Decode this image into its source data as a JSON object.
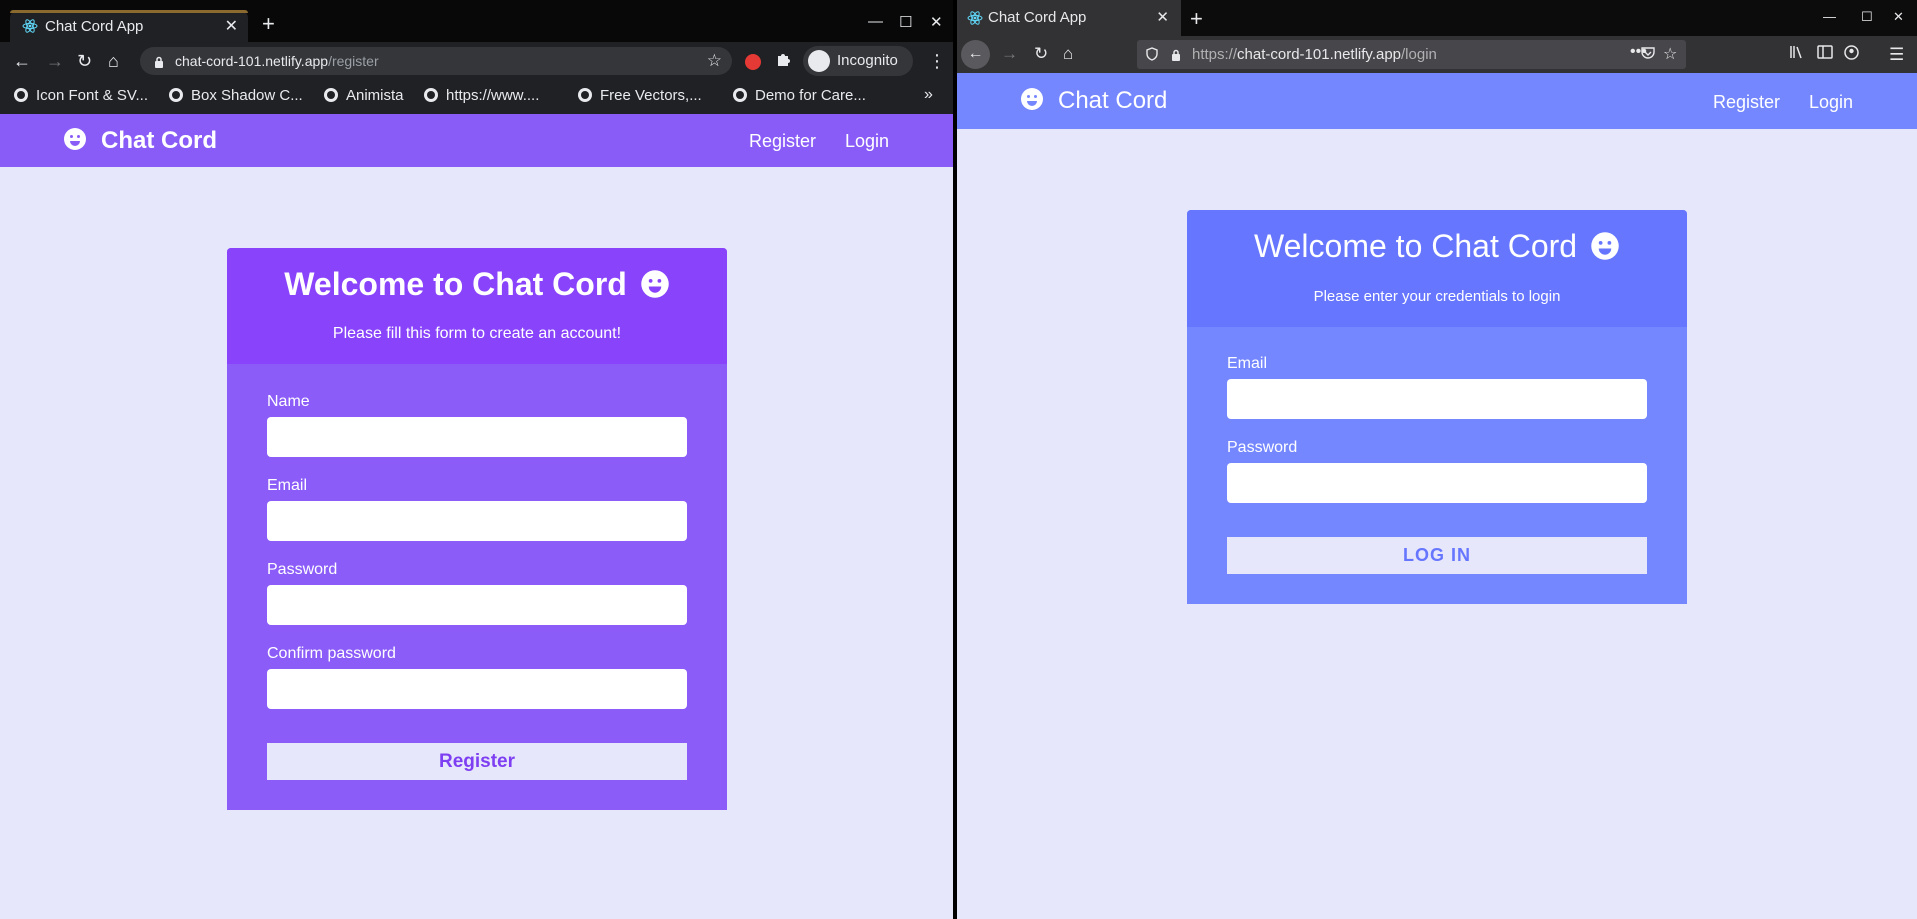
{
  "left_browser": {
    "tab_title": "Chat Cord App",
    "tab_close": "✕",
    "new_tab": "+",
    "window_controls": {
      "minimize": "—",
      "maximize": "☐",
      "close": "✕"
    },
    "nav": {
      "back": "←",
      "forward": "→",
      "reload": "↻",
      "home": "⌂"
    },
    "url_host": "chat-cord-101.netlify.app",
    "url_path": "/register",
    "star": "☆",
    "incognito_label": "Incognito",
    "menu": "⋮",
    "bookmarks": [
      "Icon Font & SV...",
      "Box Shadow C...",
      "Animista",
      "https://www....",
      "Free Vectors,...",
      "Demo for Care..."
    ],
    "bookmarks_more": "»"
  },
  "register_page": {
    "brand": "Chat Cord",
    "nav_links": {
      "register": "Register",
      "login": "Login"
    },
    "heading": "Welcome to Chat Cord",
    "subheading": "Please fill this form to create an account!",
    "fields": [
      {
        "label": "Name",
        "value": ""
      },
      {
        "label": "Email",
        "value": ""
      },
      {
        "label": "Password",
        "value": ""
      },
      {
        "label": "Confirm password",
        "value": ""
      }
    ],
    "submit_label": "Register",
    "colors": {
      "navbar": "#8a5cf7",
      "card_header": "#8843fb",
      "card_body": "#8b5cf8",
      "background": "#e7e7fb"
    }
  },
  "right_browser": {
    "tab_title": "Chat Cord App",
    "tab_close": "✕",
    "new_tab": "+",
    "window_controls": {
      "minimize": "—",
      "maximize": "☐",
      "close": "✕"
    },
    "nav": {
      "back": "←",
      "forward": "→",
      "reload": "↻",
      "home": "⌂"
    },
    "url_prefix": "https://",
    "url_host": "chat-cord-101.netlify.app",
    "url_path": "/login",
    "url_dots": "•••",
    "star": "☆",
    "menu": "☰"
  },
  "login_page": {
    "brand": "Chat Cord",
    "nav_links": {
      "register": "Register",
      "login": "Login"
    },
    "heading": "Welcome to Chat Cord",
    "subheading": "Please enter your credentials to login",
    "fields": [
      {
        "label": "Email",
        "value": ""
      },
      {
        "label": "Password",
        "value": ""
      }
    ],
    "submit_label": "LOG IN",
    "colors": {
      "navbar": "#7587ff",
      "card_header": "#6676ff",
      "card_body": "#7587ff",
      "background": "#e7e7fb"
    }
  }
}
